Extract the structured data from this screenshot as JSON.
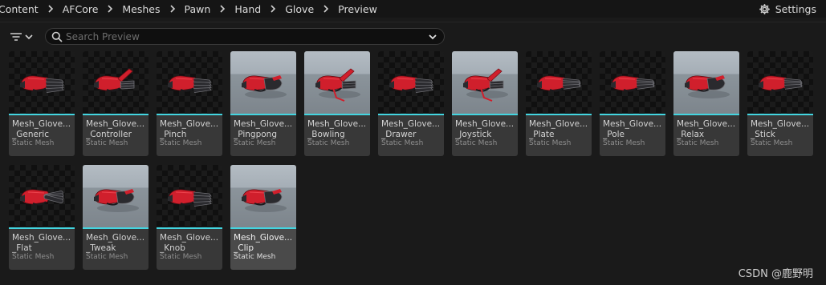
{
  "breadcrumb": [
    "Content",
    "AFCore",
    "Meshes",
    "Pawn",
    "Hand",
    "Glove",
    "Preview"
  ],
  "settings_label": "Settings",
  "search": {
    "placeholder": "Search Preview",
    "value": ""
  },
  "colors": {
    "accent": "#43d5e0",
    "glove_red": "#d01f2c",
    "glove_dark": "#2a2a2e"
  },
  "assets": [
    {
      "name_line1": "Mesh_Glove...",
      "name_line2": "_Generic",
      "type": "Static Mesh",
      "thumb": "dark",
      "pose": "open"
    },
    {
      "name_line1": "Mesh_Glove...",
      "name_line2": "_Controller",
      "type": "Static Mesh",
      "thumb": "dark",
      "pose": "grip"
    },
    {
      "name_line1": "Mesh_Glove...",
      "name_line2": "_Pinch",
      "type": "Static Mesh",
      "thumb": "dark",
      "pose": "open"
    },
    {
      "name_line1": "Mesh_Glove...",
      "name_line2": "_Pingpong",
      "type": "Static Mesh",
      "thumb": "scene",
      "pose": "fist"
    },
    {
      "name_line1": "Mesh_Glove...",
      "name_line2": "_Bowling",
      "type": "Static Mesh",
      "thumb": "scene",
      "pose": "up"
    },
    {
      "name_line1": "Mesh_Glove...",
      "name_line2": "_Drawer",
      "type": "Static Mesh",
      "thumb": "dark",
      "pose": "open"
    },
    {
      "name_line1": "Mesh_Glove...",
      "name_line2": "_Joystick",
      "type": "Static Mesh",
      "thumb": "scene",
      "pose": "up"
    },
    {
      "name_line1": "Mesh_Glove...",
      "name_line2": "_Plate",
      "type": "Static Mesh",
      "thumb": "dark",
      "pose": "flat"
    },
    {
      "name_line1": "Mesh_Glove...",
      "name_line2": "_Pole",
      "type": "Static Mesh",
      "thumb": "dark",
      "pose": "flat"
    },
    {
      "name_line1": "Mesh_Glove...",
      "name_line2": "_Relax",
      "type": "Static Mesh",
      "thumb": "scene",
      "pose": "fist"
    },
    {
      "name_line1": "Mesh_Glove...",
      "name_line2": "_Stick",
      "type": "Static Mesh",
      "thumb": "dark",
      "pose": "flat"
    },
    {
      "name_line1": "Mesh_Glove...",
      "name_line2": "_Flat",
      "type": "Static Mesh",
      "thumb": "dark",
      "pose": "spread"
    },
    {
      "name_line1": "Mesh_Glove...",
      "name_line2": "_Tweak",
      "type": "Static Mesh",
      "thumb": "scene",
      "pose": "fist"
    },
    {
      "name_line1": "Mesh_Glove...",
      "name_line2": "_Knob",
      "type": "Static Mesh",
      "thumb": "dark",
      "pose": "open"
    },
    {
      "name_line1": "Mesh_Glove...",
      "name_line2": "_Clip",
      "type": "Static Mesh",
      "thumb": "scene",
      "pose": "fist",
      "selected": true
    }
  ],
  "watermark": "CSDN @鹿野明"
}
